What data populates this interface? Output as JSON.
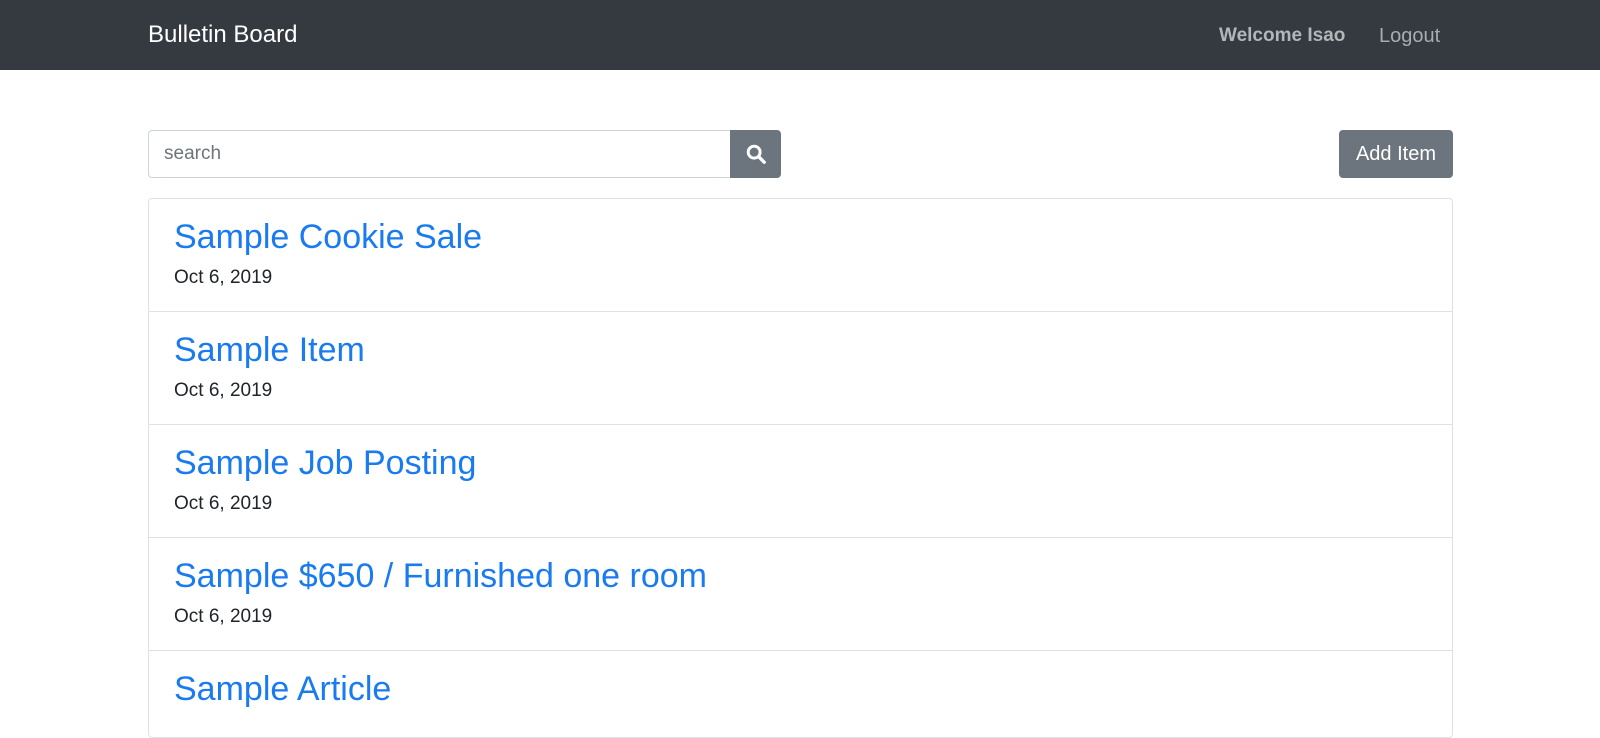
{
  "navbar": {
    "brand": "Bulletin Board",
    "welcome": "Welcome Isao",
    "logout": "Logout"
  },
  "search": {
    "placeholder": "search",
    "value": "",
    "icon": "search-icon"
  },
  "toolbar": {
    "add_label": "Add Item"
  },
  "colors": {
    "navbar_bg": "#343a40",
    "link": "#1a7bf0",
    "button": "#6c757d"
  },
  "items": [
    {
      "title": "Sample Cookie Sale",
      "date": "Oct 6, 2019"
    },
    {
      "title": "Sample Item",
      "date": "Oct 6, 2019"
    },
    {
      "title": "Sample Job Posting",
      "date": "Oct 6, 2019"
    },
    {
      "title": "Sample $650 / Furnished one room",
      "date": "Oct 6, 2019"
    },
    {
      "title": "Sample Article",
      "date": ""
    }
  ]
}
